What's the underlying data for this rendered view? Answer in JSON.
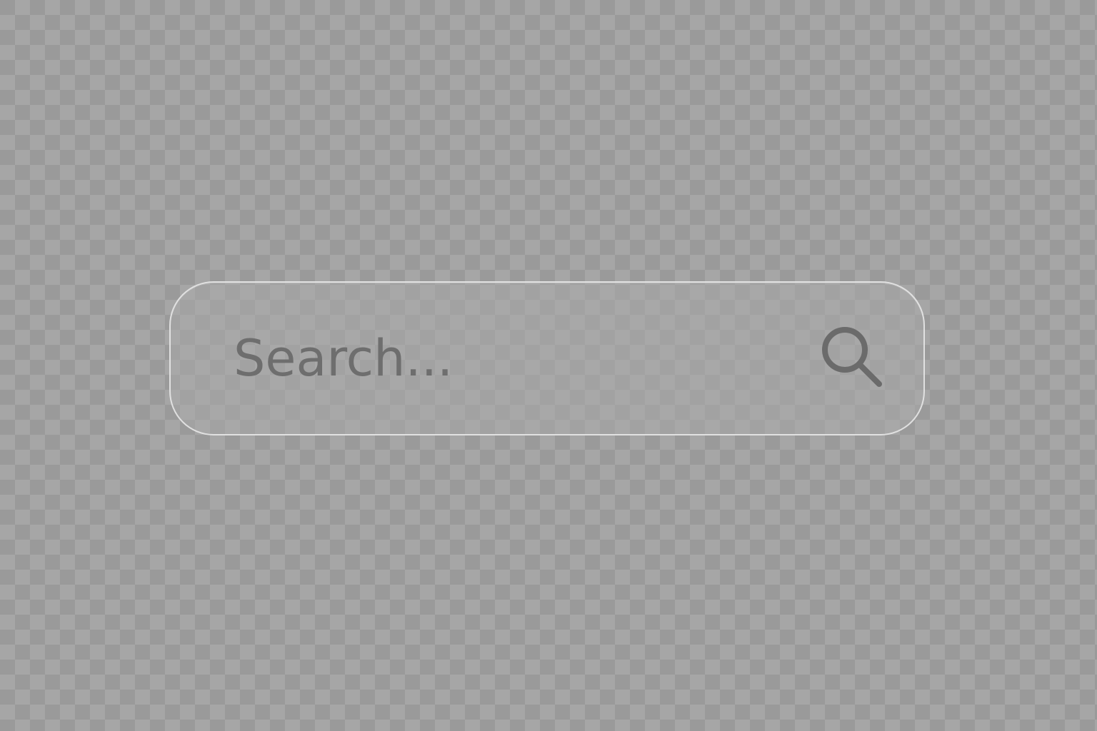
{
  "search": {
    "placeholder": "Search...",
    "value": ""
  },
  "icons": {
    "search_button_icon": "magnifying-glass"
  },
  "colors": {
    "icon": "#6b6b6b",
    "placeholder_text": "#6e6e6e",
    "field_border": "#ebebeb"
  }
}
